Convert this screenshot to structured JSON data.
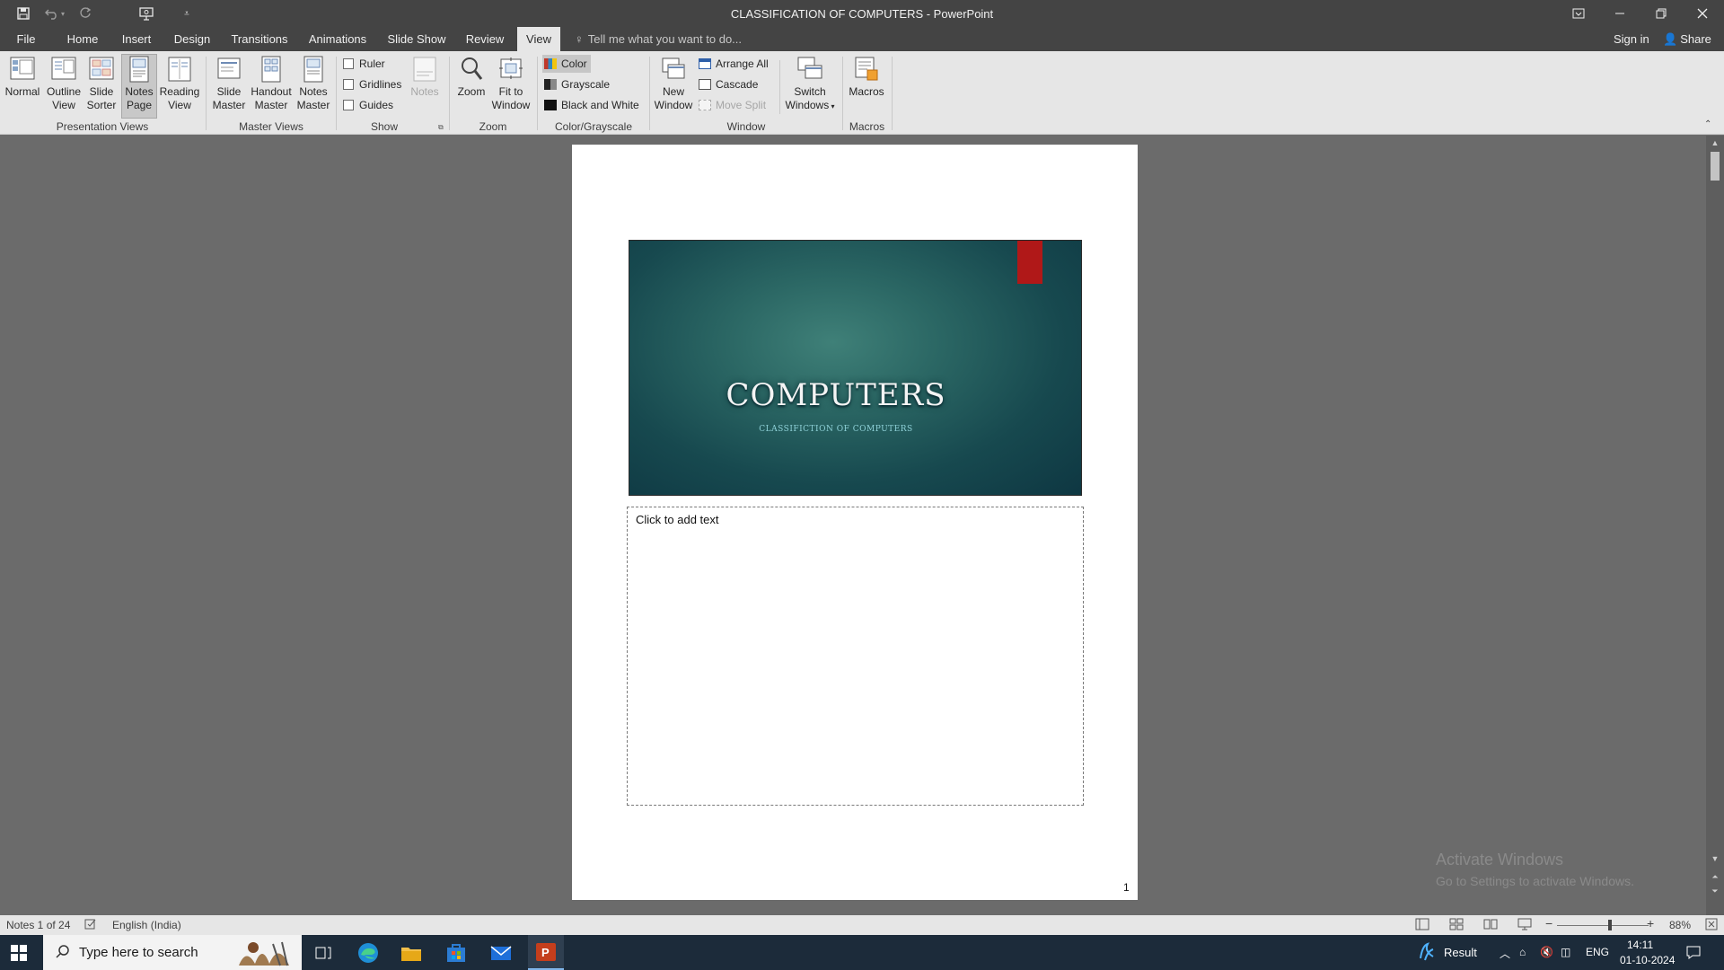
{
  "window": {
    "title": "CLASSIFICATION OF COMPUTERS - PowerPoint",
    "buttons": [
      "ribbon-display-options",
      "minimize",
      "restore",
      "close"
    ]
  },
  "quick_access": {
    "icons": [
      "save-icon",
      "undo-icon",
      "undo-dropdown-icon",
      "redo-icon",
      "present-from-beginning-icon",
      "customize-qat-icon"
    ]
  },
  "tabs": [
    {
      "label": "File"
    },
    {
      "label": "Home"
    },
    {
      "label": "Insert"
    },
    {
      "label": "Design"
    },
    {
      "label": "Transitions"
    },
    {
      "label": "Animations"
    },
    {
      "label": "Slide Show"
    },
    {
      "label": "Review"
    },
    {
      "label": "View",
      "active": true
    }
  ],
  "tell_me": "Tell me what you want to do...",
  "account": {
    "sign_in": "Sign in",
    "share": "Share"
  },
  "ribbon": {
    "presentation_views": {
      "label": "Presentation Views",
      "normal": "Normal",
      "outline": [
        "Outline",
        "View"
      ],
      "sorter": [
        "Slide",
        "Sorter"
      ],
      "notes_page": [
        "Notes",
        "Page"
      ],
      "reading": [
        "Reading",
        "View"
      ]
    },
    "master_views": {
      "label": "Master Views",
      "slide_master": [
        "Slide",
        "Master"
      ],
      "handout_master": [
        "Handout",
        "Master"
      ],
      "notes_master": [
        "Notes",
        "Master"
      ]
    },
    "show": {
      "label": "Show",
      "ruler": "Ruler",
      "gridlines": "Gridlines",
      "guides": "Guides",
      "notes": "Notes"
    },
    "zoom": {
      "label": "Zoom",
      "zoom": "Zoom",
      "fit": [
        "Fit to",
        "Window"
      ]
    },
    "color": {
      "label": "Color/Grayscale",
      "color": "Color",
      "grayscale": "Grayscale",
      "bw": "Black and White"
    },
    "window": {
      "label": "Window",
      "new_window": [
        "New",
        "Window"
      ],
      "arrange_all": "Arrange All",
      "cascade": "Cascade",
      "move_split": "Move Split",
      "switch": [
        "Switch",
        "Windows"
      ]
    },
    "macros": {
      "label": "Macros",
      "macros": "Macros"
    }
  },
  "notes_page": {
    "slide_title": "COMPUTERS",
    "slide_subtitle": "CLASSIFICTION OF COMPUTERS",
    "notes_placeholder": "Click to add text",
    "page_number": "1"
  },
  "watermark": {
    "line1": "Activate Windows",
    "line2": "Go to Settings to activate Windows."
  },
  "status": {
    "notes": "Notes 1 of 24",
    "language": "English (India)",
    "zoom": "88%",
    "zoom_level_fraction": 0.58
  },
  "taskbar": {
    "search_placeholder": "Type here to search",
    "apps": [
      "task-view-icon",
      "edge-icon",
      "file-explorer-icon",
      "store-icon",
      "mail-icon",
      "powerpoint-icon"
    ],
    "weather": "Result",
    "lang": "ENG",
    "time": "14:11",
    "date": "01-10-2024"
  },
  "colors": {
    "title_bg": "#444444",
    "ribbon_bg": "#e6e6e6",
    "workspace_bg": "#6b6b6b",
    "slide_teal": "#2b6764",
    "bookmark_red": "#b01818",
    "taskbar_bg": "#1c2b3a"
  }
}
